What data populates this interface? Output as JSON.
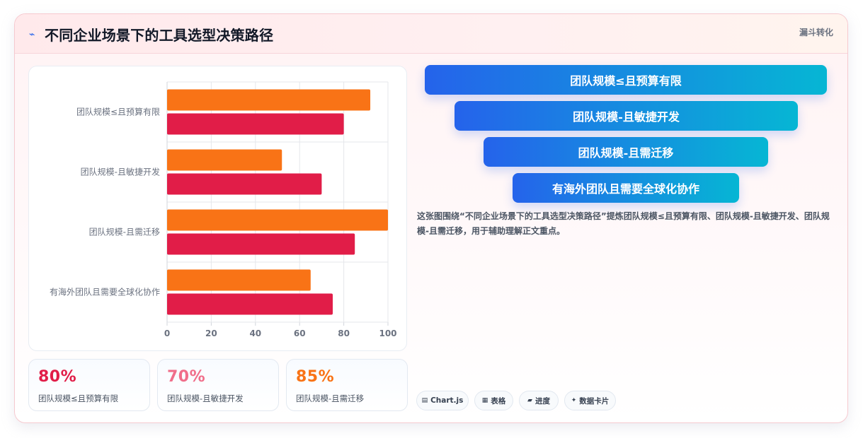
{
  "header": {
    "title": "不同企业场景下的工具选型决策路径",
    "tag": "漏斗转化",
    "icon": "bolt-icon"
  },
  "chart_data": {
    "type": "bar",
    "orientation": "horizontal",
    "categories": [
      "团队规模≤且预算有限",
      "团队规模-且敏捷开发",
      "团队规模-且需迁移",
      "有海外团队且需要全球化协作"
    ],
    "series": [
      {
        "values": [
          92,
          52,
          100,
          65
        ],
        "color": "#f97316"
      },
      {
        "values": [
          80,
          70,
          85,
          75
        ],
        "color": "#e11d48"
      }
    ],
    "xlim": [
      0,
      100
    ],
    "xticks": [
      0,
      20,
      40,
      60,
      80,
      100
    ],
    "grid": true,
    "legend": "none"
  },
  "kpis": [
    {
      "value": "80%",
      "label": "团队规模≤且预算有限",
      "color": "#e11d48"
    },
    {
      "value": "70%",
      "label": "团队规模-且敏捷开发",
      "color": "#f06e8a"
    },
    {
      "value": "85%",
      "label": "团队规模-且需迁移",
      "color": "#f97316"
    }
  ],
  "funnel": [
    {
      "label": "团队规模≤且预算有限"
    },
    {
      "label": "团队规模-且敏捷开发"
    },
    {
      "label": "团队规模-且需迁移"
    },
    {
      "label": "有海外团队且需要全球化协作"
    }
  ],
  "description": "这张图围绕“不同企业场景下的工具选型决策路径”提炼团队规模≤且预算有限、团队规模-且敏捷开发、团队规模-且需迁移，用于辅助理解正文重点。",
  "chips": [
    {
      "icon": "▤",
      "icon_name": "chart-icon",
      "label": "Chart.js"
    },
    {
      "icon": "▦",
      "icon_name": "table-icon",
      "label": "表格"
    },
    {
      "icon": "▰",
      "icon_name": "progress-icon",
      "label": "进度"
    },
    {
      "icon": "✦",
      "icon_name": "sparkle-icon",
      "label": "数据卡片"
    }
  ]
}
